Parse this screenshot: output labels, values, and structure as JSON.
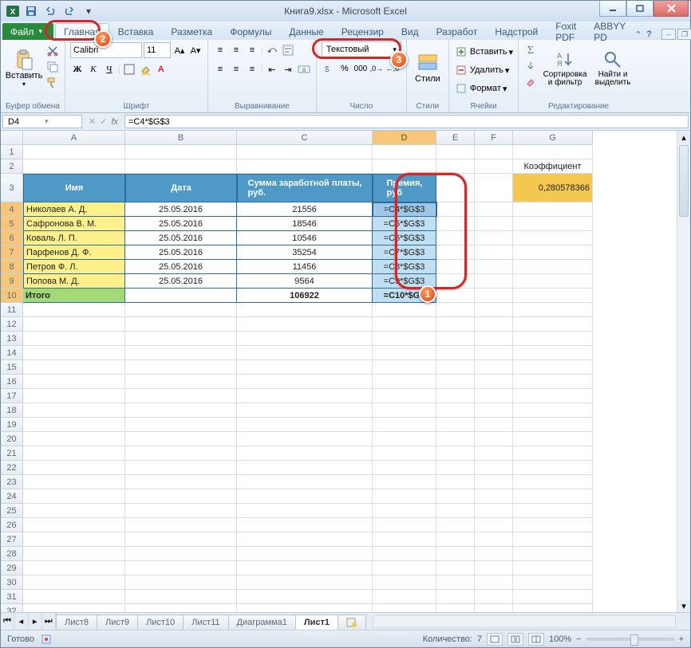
{
  "title": "Книга9.xlsx - Microsoft Excel",
  "tabs": {
    "file": "Файл",
    "items": [
      "Главная",
      "Вставка",
      "Разметка",
      "Формулы",
      "Данные",
      "Рецензир",
      "Вид",
      "Разработ",
      "Надстрой",
      "Foxit PDF",
      "ABBYY PD"
    ],
    "active": "Главная"
  },
  "ribbon": {
    "clipboard": {
      "paste": "Вставить",
      "group": "Буфер обмена"
    },
    "font": {
      "group": "Шрифт",
      "name": "Calibri",
      "size": "11"
    },
    "align": {
      "group": "Выравнивание"
    },
    "number": {
      "group": "Число",
      "format": "Текстовый"
    },
    "styles": {
      "format_as": "Стили"
    },
    "cells": {
      "group": "Ячейки",
      "insert": "Вставить",
      "delete": "Удалить",
      "format": "Формат"
    },
    "editing": {
      "group": "Редактирование",
      "sort": "Сортировка\nи фильтр",
      "find": "Найти и\nвыделить"
    }
  },
  "namebox": "D4",
  "formula": "=C4*$G$3",
  "columns": [
    "",
    "A",
    "B",
    "C",
    "D",
    "E",
    "F",
    "G"
  ],
  "row_count": 36,
  "headers": {
    "name": "Имя",
    "date": "Дата",
    "salary": "Сумма заработной платы,\nруб.",
    "bonus": "Премия,\nруб",
    "coef": "Коэффициент"
  },
  "coef_value": "0,280578366",
  "rows": [
    {
      "n": 4,
      "name": "Николаев А. Д.",
      "date": "25.05.2016",
      "salary": "21556",
      "bonus": "=C4*$G$3"
    },
    {
      "n": 5,
      "name": "Сафронова В. М.",
      "date": "25.05.2016",
      "salary": "18546",
      "bonus": "=C5*$G$3"
    },
    {
      "n": 6,
      "name": "Коваль Л. П.",
      "date": "25.05.2016",
      "salary": "10546",
      "bonus": "=C6*$G$3"
    },
    {
      "n": 7,
      "name": "Парфенов Д. Ф.",
      "date": "25.05.2016",
      "salary": "35254",
      "bonus": "=C7*$G$3"
    },
    {
      "n": 8,
      "name": "Петров Ф. Л.",
      "date": "25.05.2016",
      "salary": "11456",
      "bonus": "=C8*$G$3"
    },
    {
      "n": 9,
      "name": "Попова М. Д.",
      "date": "25.05.2016",
      "salary": "9564",
      "bonus": "=C9*$G$3"
    },
    {
      "n": 10,
      "name": "Итого",
      "date": "",
      "salary": "106922",
      "bonus": "=C10*$G$"
    }
  ],
  "sheet_tabs": [
    "Лист8",
    "Лист9",
    "Лист10",
    "Лист11",
    "Диаграмма1",
    "Лист1"
  ],
  "active_sheet": "Лист1",
  "status": {
    "ready": "Готово",
    "count_label": "Количество:",
    "count": "7",
    "zoom": "100%"
  }
}
